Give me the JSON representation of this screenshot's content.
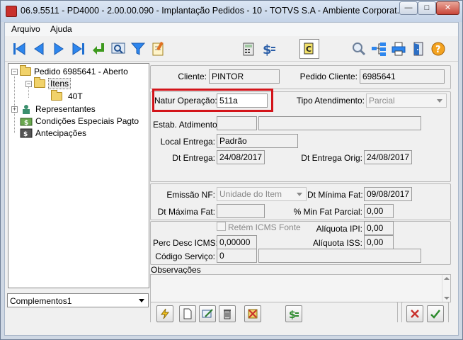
{
  "window": {
    "title": "06.9.5511 - PD4000 - 2.00.00.090 - Implantação Pedidos - 10 - TOTVS S.A - Ambiente Corporat...",
    "minimize_icon": "minimize-icon",
    "maximize_icon": "maximize-icon",
    "close_icon": "close-icon"
  },
  "menu": {
    "file": "Arquivo",
    "help": "Ajuda"
  },
  "toolbar": {
    "icons": [
      "first-record-icon",
      "previous-record-icon",
      "next-record-icon",
      "last-record-icon",
      "confirm-enter-icon",
      "search-screen-icon",
      "filter-icon",
      "edit-document-icon",
      "calculator-icon",
      "price-dollar-icon",
      "copy-icon",
      "zoom-icon",
      "tree-structure-icon",
      "print-icon",
      "exit-door-icon",
      "help-icon"
    ]
  },
  "tree": {
    "root": "Pedido 6985641 - Aberto",
    "items": "Itens",
    "item_40t": "40T",
    "representantes": "Representantes",
    "condicoes": "Condições Especiais Pagto",
    "antecipacoes": "Antecipações"
  },
  "combo": {
    "value": "Complementos1"
  },
  "form": {
    "cliente_label": "Cliente:",
    "cliente_value": "PINTOR",
    "pedido_cliente_label": "Pedido Cliente:",
    "pedido_cliente_value": "6985641",
    "natur_label": "Natur Operação:",
    "natur_value": "511a",
    "tipo_atend_label": "Tipo Atendimento:",
    "tipo_atend_value": "Parcial",
    "estab_label": "Estab. Atdimento:",
    "estab_value": "",
    "estab_desc": "",
    "local_entrega_label": "Local Entrega:",
    "local_entrega_value": "Padrão",
    "dt_entrega_label": "Dt Entrega:",
    "dt_entrega_value": "24/08/2017",
    "dt_entrega_orig_label": "Dt Entrega Orig:",
    "dt_entrega_orig_value": "24/08/2017",
    "emissao_nf_label": "Emissão NF:",
    "emissao_nf_value": "Unidade do Item",
    "dt_minima_fat_label": "Dt Mínima Fat:",
    "dt_minima_fat_value": "09/08/2017",
    "dt_maxima_fat_label": "Dt Máxima Fat:",
    "dt_maxima_fat_value": "",
    "min_fat_parcial_label": "% Min Fat Parcial:",
    "min_fat_parcial_value": "0,00",
    "retem_icms_label": "Retém ICMS Fonte",
    "aliquota_ipi_label": "Alíquota IPI:",
    "aliquota_ipi_value": "0,00",
    "perc_desc_icms_label": "Perc Desc ICMS:",
    "perc_desc_icms_value": "0,00000",
    "aliquota_iss_label": "Alíquota ISS:",
    "aliquota_iss_value": "0,00",
    "codigo_servico_label": "Código Serviço:",
    "codigo_servico_value": "0",
    "codigo_servico_desc": "",
    "observacoes_label": "Observações"
  },
  "colors": {
    "highlight_box": "#d3141a",
    "title_bar": "#c4d3e7"
  }
}
